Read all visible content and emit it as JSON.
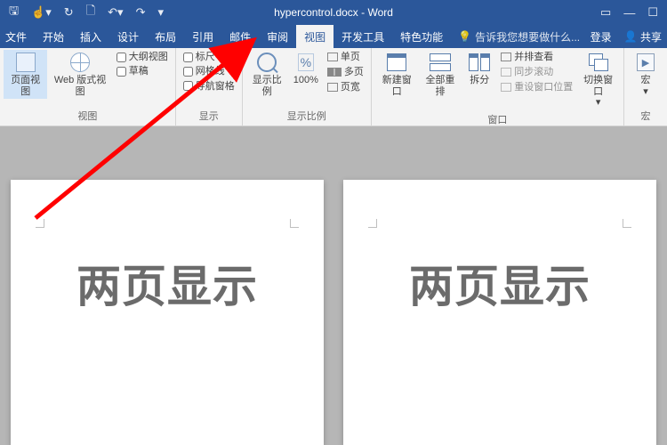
{
  "titlebar": {
    "doc_title": "hypercontrol.docx - Word"
  },
  "tabs": {
    "file": "文件",
    "home": "开始",
    "insert": "插入",
    "design": "设计",
    "layout": "布局",
    "references": "引用",
    "mailings": "邮件",
    "review": "审阅",
    "view": "视图",
    "devtools": "开发工具",
    "special": "特色功能",
    "tell_me": "告诉我您想要做什么...",
    "login": "登录",
    "share": "共享"
  },
  "ribbon": {
    "views_group": "视图",
    "print_layout": "页面视图",
    "web_layout": "Web 版式视图",
    "outline": "大纲视图",
    "draft": "草稿",
    "show_group": "显示",
    "ruler": "标尺",
    "gridlines": "网格线",
    "nav_pane": "导航窗格",
    "zoom_group": "显示比例",
    "zoom": "显示比例",
    "zoom_100": "100%",
    "one_page": "单页",
    "multi_page": "多页",
    "page_width": "页宽",
    "window_group": "窗口",
    "new_window": "新建窗口",
    "arrange_all": "全部重排",
    "split": "拆分",
    "side_by_side": "并排查看",
    "sync_scroll": "同步滚动",
    "reset_pos": "重设窗口位置",
    "switch_window": "切换窗口",
    "macros_group": "宏",
    "macros": "宏"
  },
  "document": {
    "page_text": "两页显示"
  }
}
